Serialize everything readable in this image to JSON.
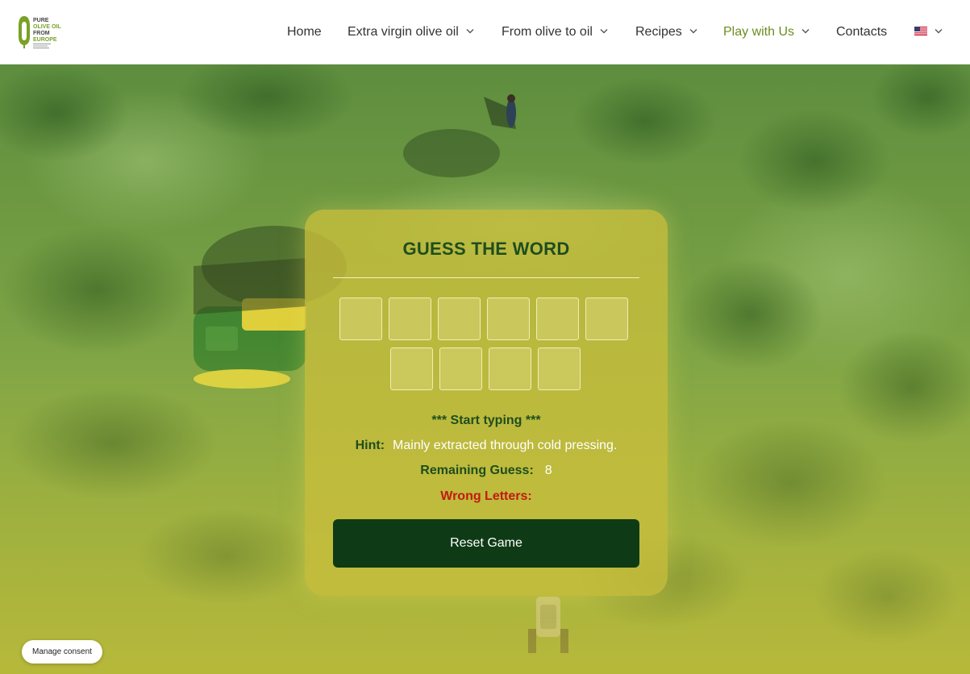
{
  "brand": {
    "logo_lines": [
      "PURE",
      "OLIVE OIL",
      "FROM",
      "EUROPE"
    ]
  },
  "nav": {
    "items": [
      {
        "label": "Home",
        "dropdown": false
      },
      {
        "label": "Extra virgin olive oil",
        "dropdown": true
      },
      {
        "label": "From olive to oil",
        "dropdown": true
      },
      {
        "label": "Recipes",
        "dropdown": true
      },
      {
        "label": "Play with Us",
        "dropdown": true,
        "active": true
      },
      {
        "label": "Contacts",
        "dropdown": false
      }
    ],
    "language": {
      "icon": "us-flag-icon",
      "dropdown": true
    }
  },
  "game": {
    "title": "GUESS THE WORD",
    "letter_count": 10,
    "status": "*** Start typing ***",
    "hint_label": "Hint:",
    "hint": "Mainly extracted through cold pressing.",
    "remaining_label": "Remaining Guess:",
    "remaining": "8",
    "wrong_label": "Wrong Letters:",
    "wrong_letters": "",
    "reset_label": "Reset Game"
  },
  "consent": {
    "label": "Manage consent"
  },
  "colors": {
    "brand_green": "#6a8e1f",
    "title_green": "#1f4d1e",
    "button_dark": "#0e3b16",
    "wrong_red": "#c21a12",
    "card_yellow": "#c8be3c"
  }
}
